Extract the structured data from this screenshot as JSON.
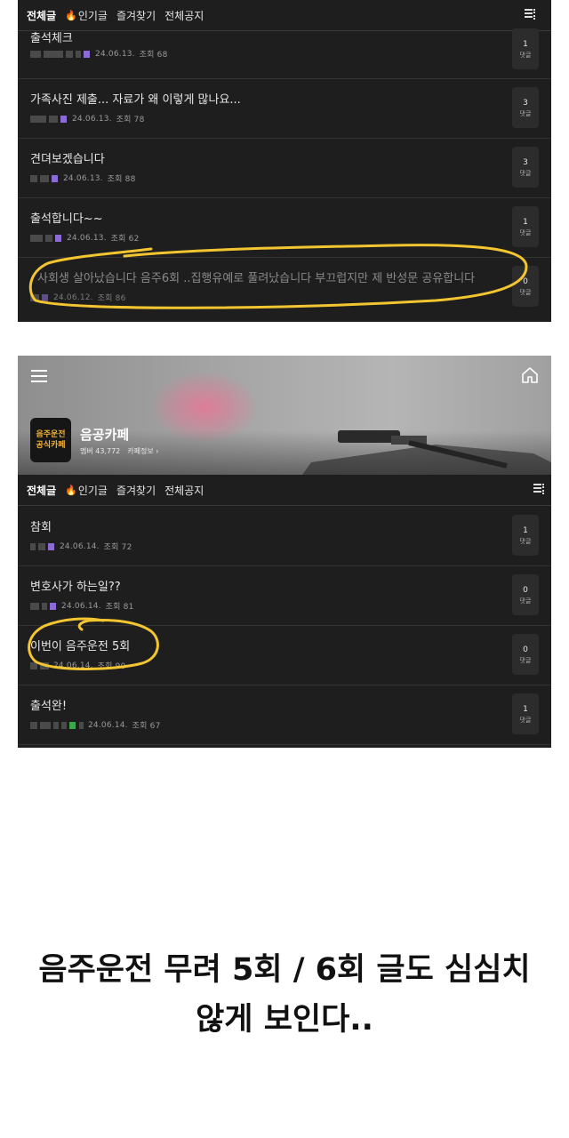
{
  "screenshot_top": {
    "tabs": [
      {
        "label": "전체글",
        "active": true
      },
      {
        "label": "인기글",
        "icon": "fire-icon"
      },
      {
        "label": "즐겨찾기"
      },
      {
        "label": "전체공지"
      }
    ],
    "posts": [
      {
        "title": "출석체크",
        "date": "24.06.13.",
        "views": "조회 68",
        "comments": "1",
        "comment_label": "댓글"
      },
      {
        "title": "가족사진 제출... 자료가 왜 이렇게 많나요...",
        "date": "24.06.13.",
        "views": "조회 78",
        "comments": "3",
        "comment_label": "댓글"
      },
      {
        "title": "견뎌보겠습니다",
        "date": "24.06.13.",
        "views": "조회 88",
        "comments": "3",
        "comment_label": "댓글"
      },
      {
        "title": "출석합니다~~",
        "date": "24.06.13.",
        "views": "조회 62",
        "comments": "1",
        "comment_label": "댓글"
      },
      {
        "title": "사회생 살아났습니다 음주6회 ..집행유예로 풀려났습니다 부끄럽지만 제 반성문 공유합니다",
        "date": "24.06.12.",
        "views": "조회 86",
        "comments": "0",
        "comment_label": "댓글"
      }
    ]
  },
  "screenshot_bottom": {
    "cafe": {
      "name": "음공카페",
      "members": "멤버 43,772",
      "info_link": "카페정보 ›",
      "logo_text": "음주운전\n공식카페"
    },
    "tabs": [
      {
        "label": "전체글",
        "active": true
      },
      {
        "label": "인기글",
        "icon": "fire-icon"
      },
      {
        "label": "즐겨찾기"
      },
      {
        "label": "전체공지"
      }
    ],
    "posts": [
      {
        "title": "참회",
        "date": "24.06.14.",
        "views": "조회 72",
        "comments": "1",
        "comment_label": "댓글"
      },
      {
        "title": "변호사가 하는일??",
        "date": "24.06.14.",
        "views": "조회 81",
        "comments": "0",
        "comment_label": "댓글"
      },
      {
        "title": "이번이 음주운전 5회",
        "date": "24.06.14.",
        "views": "조회 90",
        "comments": "0",
        "comment_label": "댓글"
      },
      {
        "title": "출석완!",
        "date": "24.06.14.",
        "views": "조회 67",
        "comments": "1",
        "comment_label": "댓글"
      }
    ]
  },
  "caption": {
    "line1": "음주운전 무려 5회 / 6회 글도 심심치",
    "line2": "않게 보인다.."
  },
  "colors": {
    "highlight": "#f2c531",
    "level_badge": "#8c6bd6",
    "level_badge_green": "#3aa84a",
    "fire": "#ff6a1a"
  }
}
